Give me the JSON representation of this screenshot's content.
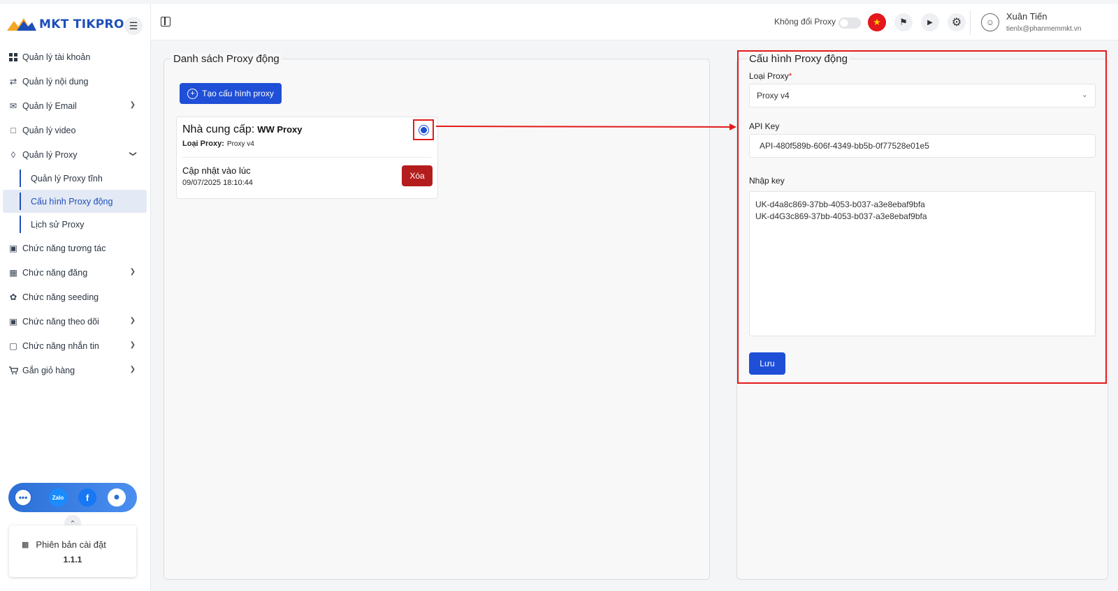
{
  "brand": {
    "name": "MKT TIKPRO"
  },
  "sidebar": {
    "items": [
      {
        "label": "Quản lý tài khoản",
        "icon": "grid-icon",
        "has_chevron": false
      },
      {
        "label": "Quản lý nội dung",
        "icon": "swap-icon",
        "has_chevron": false
      },
      {
        "label": "Quản lý Email",
        "icon": "mail-icon",
        "has_chevron": true
      },
      {
        "label": "Quản lý video",
        "icon": "video-icon",
        "has_chevron": false
      },
      {
        "label": "Quản lý Proxy",
        "icon": "proxy-icon",
        "has_chevron": true,
        "expanded": true
      }
    ],
    "proxy_sub": [
      {
        "label": "Quản lý Proxy tĩnh"
      },
      {
        "label": "Cấu hình Proxy động",
        "active": true
      },
      {
        "label": "Lịch sử Proxy"
      }
    ],
    "items_after": [
      {
        "label": "Chức năng tương tác",
        "icon": "interact-icon",
        "has_chevron": false
      },
      {
        "label": "Chức năng đăng",
        "icon": "post-icon",
        "has_chevron": true
      },
      {
        "label": "Chức năng seeding",
        "icon": "seed-icon",
        "has_chevron": false
      },
      {
        "label": "Chức năng theo dõi",
        "icon": "follow-icon",
        "has_chevron": true
      },
      {
        "label": "Chức năng nhắn tin",
        "icon": "message-icon",
        "has_chevron": true
      },
      {
        "label": "Gắn giỏ hàng",
        "icon": "cart-icon",
        "has_chevron": true
      }
    ],
    "social": {
      "zalo": "Zalo",
      "facebook": "f"
    },
    "version_title": "Phiên bản cài đặt",
    "version": "1.1.1"
  },
  "header": {
    "proxy_toggle_label": "Không đổi Proxy",
    "proxy_toggle_on": false,
    "user_name": "Xuân Tiến",
    "user_email": "tienlx@phanmemmkt.vn"
  },
  "left_panel": {
    "title": "Danh sách Proxy động",
    "create_button": "Tạo cấu hình proxy",
    "provider_card": {
      "provider_label": "Nhà cung cấp:",
      "provider_name": "WW Proxy",
      "type_label": "Loại Proxy:",
      "type_value": "Proxy v4",
      "updated_label": "Cập nhật vào lúc",
      "updated_time": "09/07/2025 18:10:44",
      "delete_button": "Xóa",
      "selected": true
    }
  },
  "right_panel": {
    "title": "Cấu hình Proxy động",
    "proxy_type_label": "Loại Proxy",
    "proxy_type_required": "*",
    "proxy_type_value": "Proxy v4",
    "api_key_label": "API Key",
    "api_key_value": "API-480f589b-606f-4349-bb5b-0f77528e01e5",
    "key_input_label": "Nhập key",
    "keys": [
      "UK-d4a8c869-37bb-4053-b037-a3e8ebaf9bfa",
      "UK-d4G3c869-37bb-4053-b037-a3e8ebaf9bfa"
    ],
    "save_button": "Lưu"
  },
  "colors": {
    "primary": "#1f4fd6",
    "danger": "#b41d1d",
    "highlight": "#e31b1b",
    "sidebar_active_bg": "#e3e9f5"
  }
}
